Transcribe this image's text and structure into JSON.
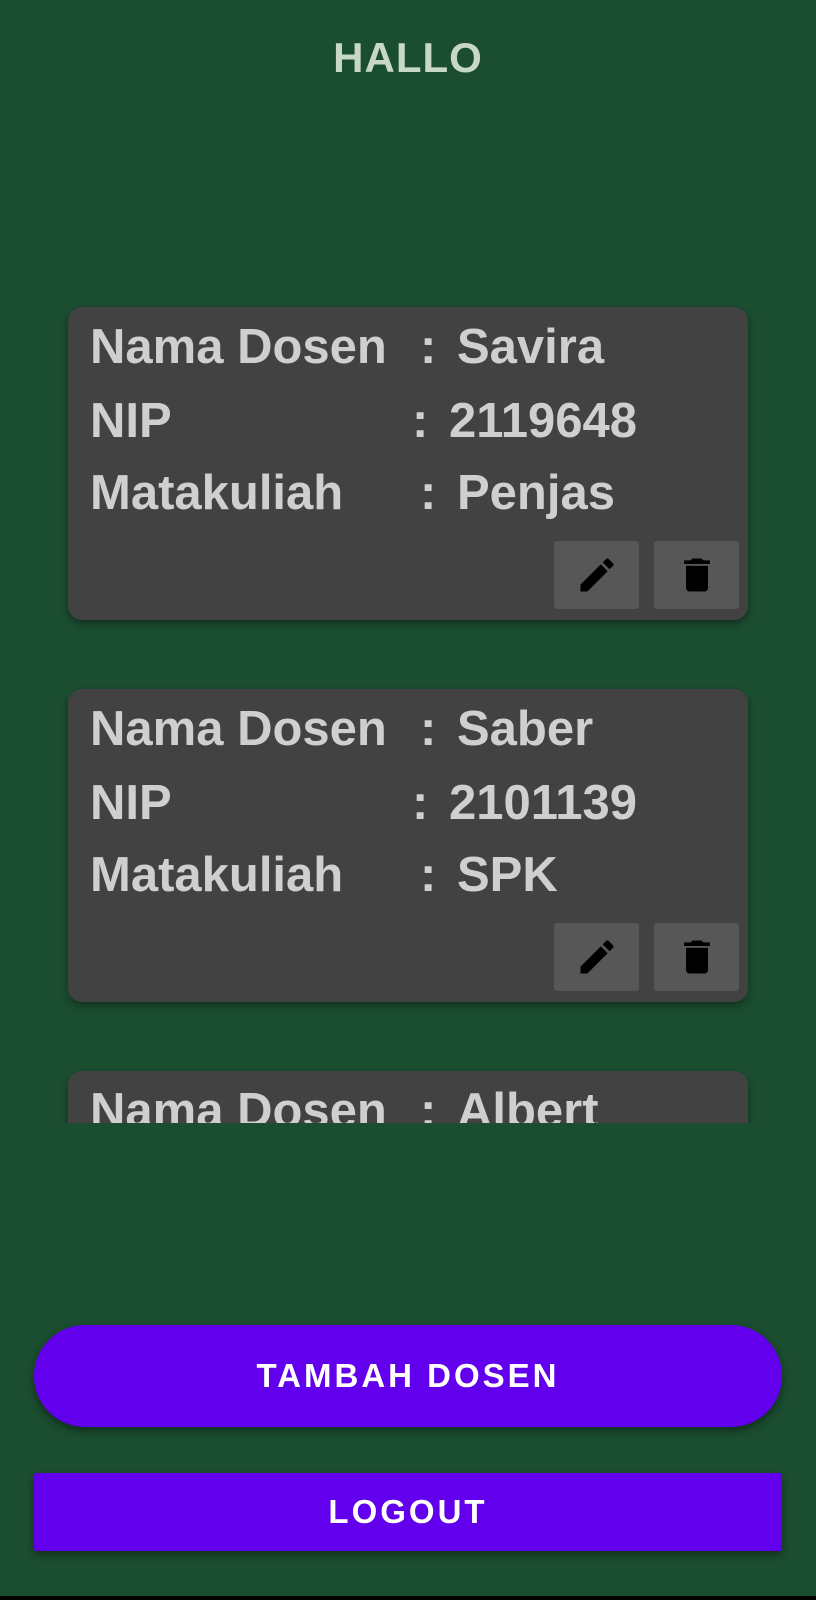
{
  "header": {
    "title": "HALLO"
  },
  "cards": [
    {
      "name_label": "Nama Dosen",
      "name_value": "Savira",
      "nip_label": "NIP",
      "nip_value": "2119648",
      "course_label": "Matakuliah",
      "course_value": "Penjas",
      "colon": ":"
    },
    {
      "name_label": "Nama Dosen",
      "name_value": "Saber",
      "nip_label": "NIP",
      "nip_value": "2101139",
      "course_label": "Matakuliah",
      "course_value": "SPK",
      "colon": ":"
    },
    {
      "name_label": "Nama Dosen",
      "name_value": "Albert",
      "colon": ":"
    }
  ],
  "buttons": {
    "add_label": "TAMBAH DOSEN",
    "logout_label": "LOGOUT"
  },
  "icons": {
    "edit": "pencil-icon",
    "delete": "trash-icon"
  },
  "colors": {
    "background": "#1b4d30",
    "card": "#424242",
    "primary": "#6200ee"
  }
}
